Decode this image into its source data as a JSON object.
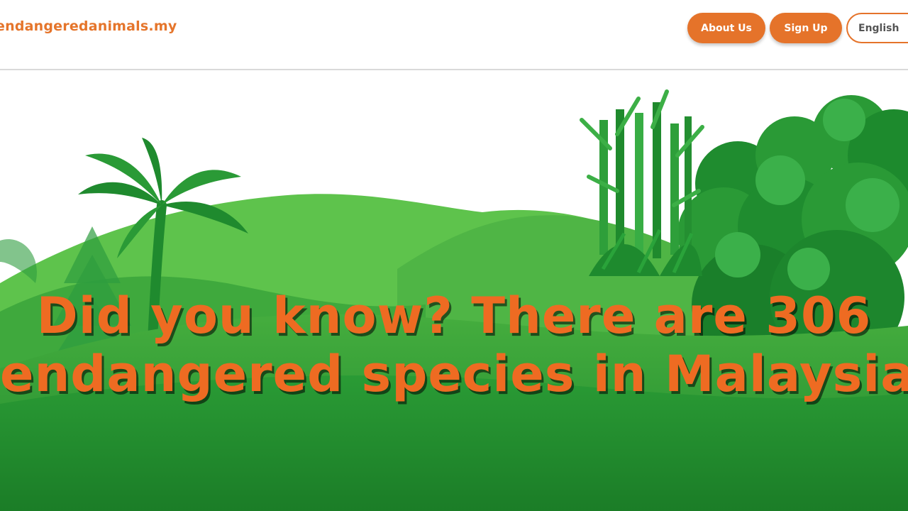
{
  "header": {
    "logo_text": "endangeredanimals.my",
    "nav": {
      "about_label": "About Us",
      "signup_label": "Sign Up",
      "language_label": "English"
    }
  },
  "hero": {
    "headline_line1": "Did you know? There are 306",
    "headline_line2": "endangered species in Malaysia."
  },
  "colors": {
    "accent": "#e5732a",
    "headline": "#ee6b22",
    "hill_light": "#5fc04a",
    "hill_dark": "#1f8a2e",
    "foliage": "#2e9d3f"
  },
  "icons": [
    "palm-tree-icon",
    "bamboo-icon",
    "bush-tree-icon",
    "fern-icon"
  ]
}
